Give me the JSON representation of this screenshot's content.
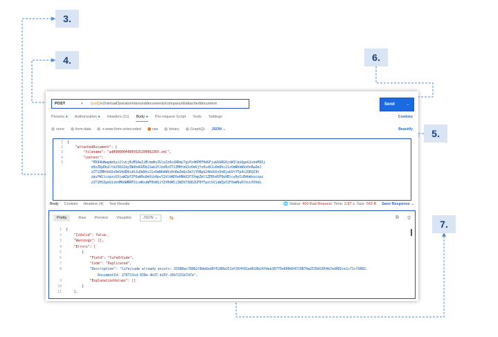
{
  "callouts": {
    "c3": "3.",
    "c4": "4.",
    "c5": "5.",
    "c6": "6.",
    "c7": "7."
  },
  "colors": {
    "accent": "#1b6be0",
    "highlight": "#1f4fcf",
    "callout_bg": "#d9e4f5",
    "orange": "#e8771c",
    "error": "#c0392b"
  },
  "request": {
    "method": "POST",
    "url_var": "{{url}}",
    "url_path": "/v2/virtualOperator/inbounddocuments/companyId/attacheddocument",
    "send_label": "Send",
    "tabs": [
      "Params",
      "Authorization",
      "Headers (11)",
      "Body",
      "Pre-request Script",
      "Tests",
      "Settings"
    ],
    "cookies_label": "Cookies",
    "body_options": [
      "none",
      "form-data",
      "x-www-form-urlencoded",
      "raw",
      "binary",
      "GraphQL"
    ],
    "format": "JSON",
    "beautify_label": "Beautify",
    "body_lines": [
      "{",
      "    \"attachedDocument\": {",
      "        \"filename\": \"ad00000044005025200002365.xml\",",
      "        \"content\":",
      "            \"PD94bWwgdmVyc2lvbj0iMS4wIiBlbmNvZGluZz0idXRmLTgiPz4KPEF0dGFjaGVkRG9jdW1lbnQgeG1sbnM9Ij",
      "            nHzZDpDb2ltb25022dyZWdhdGVDb21wb25lbnRzIT1IMHtbG5zOmVjYz0idXJuOm9hc21zOmNhbWVzOnRwZmJ",
      "            zIT1IMHtbG5zOmV4dD0idXJuOm9hc21zOmNhbWVzOnRwZmQxZmJjYXRpb246dGVsOnRjaGVtYTp4c2Q6Q29t",
      "            zpuYW1lczpzcGVjaWZpY2F0aW9uOmVib0pvY2hlbWE6eHNkO1F3YmpZml1ZERhdGF0eXBlcy0yIiB4bWxuczpz",
      "            zIT1HSIgeG1sbnM6dWRRPS1cmRsaWF0bW1iY2V0dW5jZWZhY3Q6ZGF0YTpzcGVjaWZpY2F0aW9uOlVucXVhbG"
    ]
  },
  "response": {
    "tabs": [
      "Body",
      "Cookies",
      "Headers (4)",
      "Test Results"
    ],
    "status_label": "Status:",
    "status_value": "400 Bad Request",
    "time_label": "Time:",
    "time_value": "3.87 s",
    "size_label": "Size:",
    "size_value": "543 B",
    "save_label": "Save Response",
    "view_tabs": [
      "Pretty",
      "Raw",
      "Preview",
      "Visualize"
    ],
    "format": "JSON",
    "lines": [
      "{",
      "    \"IsValid\": false,",
      "    \"Warnings\": [],",
      "    \"Errors\": [",
      "        {",
      "            \"Field\": \"CufeOrCude\",",
      "            \"Code\": \"Duplicated\",",
      "            \"Description\": \"Cufe/cude already exists: 33380ac78862f8de6ed8f5280e251df354f81ad610b24fdeb30775e608d54729874a2539d1954b7ed002ce1c71cf3002.",
      "                DocumentId: 276713cd-939e-4b37-b25f-26b7131b7d7e\",",
      "            \"ExplanationValues\": []",
      "        }",
      "    ],"
    ]
  }
}
